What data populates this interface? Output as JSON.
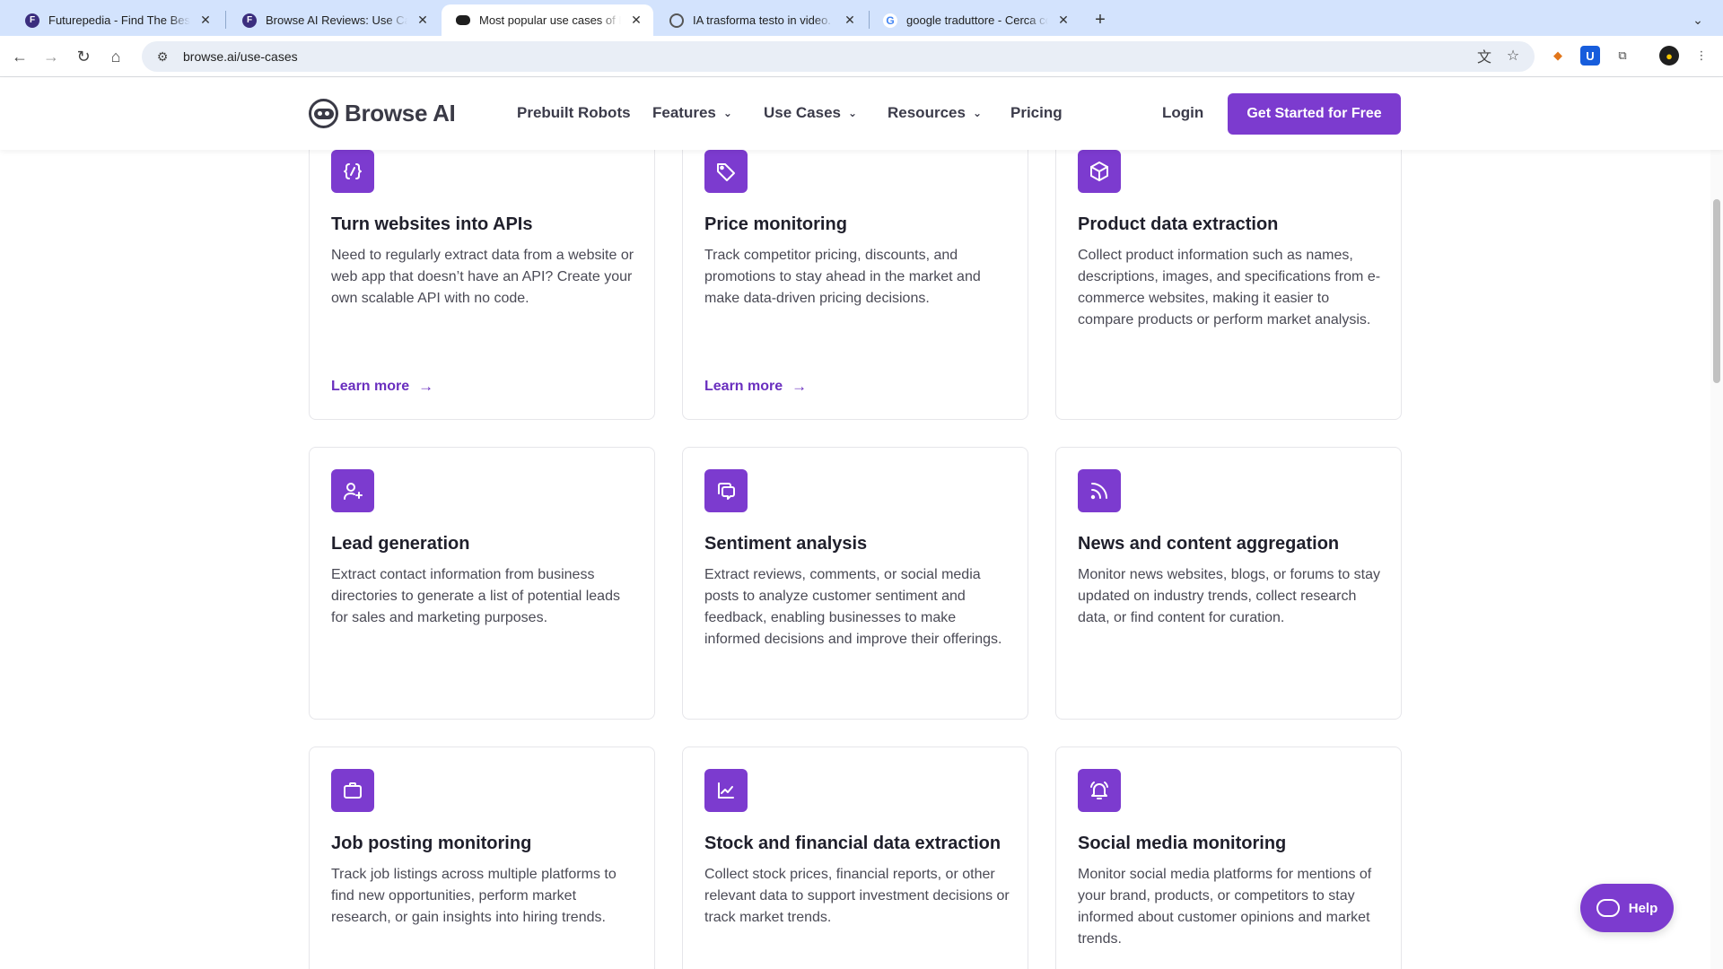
{
  "browser": {
    "tabs": [
      {
        "title": "Futurepedia - Find The Best AI",
        "favicon": "F",
        "active": false
      },
      {
        "title": "Browse AI Reviews: Use Cases",
        "favicon": "F",
        "active": false
      },
      {
        "title": "Most popular use cases of Browse AI",
        "favicon": "",
        "active": true
      },
      {
        "title": "IA trasforma testo in video.",
        "favicon": "",
        "active": false
      },
      {
        "title": "google traduttore - Cerca con Google",
        "favicon": "G",
        "active": false
      }
    ],
    "url": "browse.ai/use-cases"
  },
  "header": {
    "logo_text": "Browse AI",
    "nav": [
      {
        "label": "Prebuilt Robots",
        "has_dropdown": false
      },
      {
        "label": "Features",
        "has_dropdown": true
      },
      {
        "label": "Use Cases",
        "has_dropdown": true
      },
      {
        "label": "Resources",
        "has_dropdown": true
      },
      {
        "label": "Pricing",
        "has_dropdown": false
      }
    ],
    "login_label": "Login",
    "cta_label": "Get Started for Free"
  },
  "cards": [
    {
      "icon": "code-brackets-icon",
      "title": "Turn websites into APIs",
      "description": "Need to regularly extract data from a website or web app that doesn’t have an API? Create your own scalable API with no code.",
      "link": "Learn more"
    },
    {
      "icon": "price-tag-icon",
      "title": "Price monitoring",
      "description": "Track competitor pricing, discounts, and promotions to stay ahead in the market and make data-driven pricing decisions.",
      "link": "Learn more"
    },
    {
      "icon": "cube-icon",
      "title": "Product data extraction",
      "description": "Collect product information such as names, descriptions, images, and specifications from e-commerce websites, making it easier to compare products or perform market analysis.",
      "link": ""
    },
    {
      "icon": "user-plus-icon",
      "title": "Lead generation",
      "description": "Extract contact information from business directories to generate a list of potential leads for sales and marketing purposes.",
      "link": ""
    },
    {
      "icon": "chat-bubbles-icon",
      "title": "Sentiment analysis",
      "description": "Extract reviews, comments, or social media posts to analyze customer sentiment and feedback, enabling businesses to make informed decisions and improve their offerings.",
      "link": ""
    },
    {
      "icon": "rss-feed-icon",
      "title": "News and content aggregation",
      "description": "Monitor news websites, blogs, or forums to stay updated on industry trends, collect research data, or find content for curation.",
      "link": ""
    },
    {
      "icon": "briefcase-icon",
      "title": "Job posting monitoring",
      "description": "Track job listings across multiple platforms to find new opportunities, perform market research, or gain insights into hiring trends.",
      "link": ""
    },
    {
      "icon": "chart-trend-icon",
      "title": "Stock and financial data extraction",
      "description": "Collect stock prices, financial reports, or other relevant data to support investment decisions or track market trends.",
      "link": ""
    },
    {
      "icon": "bell-ringing-icon",
      "title": "Social media monitoring",
      "description": "Monitor social media platforms for mentions of your brand, products, or competitors to stay informed about customer opinions and market trends.",
      "link": ""
    }
  ],
  "help_label": "Help",
  "colors": {
    "accent": "#7c3bcf",
    "link": "#6a2fbf"
  }
}
